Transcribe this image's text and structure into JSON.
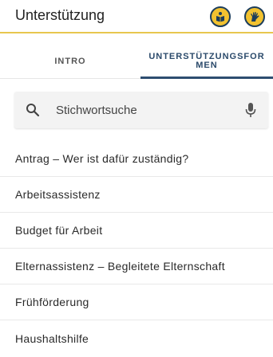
{
  "header": {
    "title": "Unterstützung",
    "actions": [
      {
        "icon": "sign-language-book-icon"
      },
      {
        "icon": "sign-language-hand-icon"
      }
    ]
  },
  "colors": {
    "accent_yellow": "#f2c230",
    "accent_navy": "#2e4e70"
  },
  "tabs": [
    {
      "label": "INTRO",
      "selected": false
    },
    {
      "label": "UNTERSTÜTZUNGSFOR\nMEN",
      "selected": true
    }
  ],
  "search": {
    "placeholder": "Stichwortsuche"
  },
  "list": {
    "items": [
      "Antrag – Wer ist dafür zuständig?",
      "Arbeitsassistenz",
      "Budget für Arbeit",
      "Elternassistenz – Begleitete Elternschaft",
      "Frühförderung",
      "Haushaltshilfe"
    ]
  }
}
